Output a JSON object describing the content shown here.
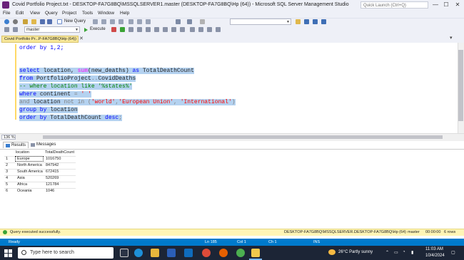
{
  "window": {
    "title": "Covid Portfolio Project.txt - DESKTOP-FA7G8BQ\\MSSQLSERVER1.master (DESKTOP-FA7G8BQ\\Hp (64)) - Microsoft SQL Server Management Studio",
    "quick_launch_placeholder": "Quick Launch (Ctrl+Q)",
    "minimize_glyph": "—",
    "maximize_glyph": "☐",
    "close_glyph": "✕"
  },
  "menu": [
    "File",
    "Edit",
    "View",
    "Query",
    "Project",
    "Tools",
    "Window",
    "Help"
  ],
  "toolbar": {
    "new_query_label": "New Query",
    "database_value": "master",
    "execute_label": "Execute"
  },
  "document_tab": {
    "label": "Covid Portfolio Pr...P-FA7G8BQ\\Hp (64))",
    "close_glyph": "✕",
    "active_color": "#f7e79a"
  },
  "editor": {
    "line_prev": "order by 1,2;",
    "code": {
      "l1_kw1": "select",
      "l1_a": " location, ",
      "l1_fn": "sum",
      "l1_b": "(new_deaths) ",
      "l1_kw2": "as",
      "l1_c": " TotalDeathCount",
      "l2_kw": "from",
      "l2_a": " PortfolioProject",
      "l2_gr": "..",
      "l2_b": "CovidDeaths",
      "l3_cm": "-- where location like '%states%'",
      "l4_kw": "where",
      "l4_a": " continent ",
      "l4_gr": "=",
      "l4_str": " ' '",
      "l5_kw1": "and",
      "l5_a": " location ",
      "l5_gr1": "not in",
      "l5_gr2": " (",
      "l5_str1": "'world'",
      "l5_gr3": ",",
      "l5_str2": "'European Union'",
      "l5_gr4": ", ",
      "l5_str3": "'International'",
      "l5_gr5": ")",
      "l6_kw": "group by",
      "l6_a": " location",
      "l7_kw1": "order by",
      "l7_a": " TotalDeathCount ",
      "l7_kw2": "desc",
      "l7_gr": ";"
    },
    "selection_color": "#b4d2f0"
  },
  "zoom": "136 %",
  "results": {
    "tabs": [
      "Results",
      "Messages"
    ],
    "columns": [
      "location",
      "TotalDeathCount"
    ],
    "rows": [
      {
        "n": "1",
        "location": "Europe",
        "count": "1016750"
      },
      {
        "n": "2",
        "location": "North America",
        "count": "847942"
      },
      {
        "n": "3",
        "location": "South America",
        "count": "672415"
      },
      {
        "n": "4",
        "location": "Asia",
        "count": "520269"
      },
      {
        "n": "5",
        "location": "Africa",
        "count": "121784"
      },
      {
        "n": "6",
        "location": "Oceania",
        "count": "1046"
      }
    ]
  },
  "query_status": {
    "message": "Query executed successfully.",
    "server": "DESKTOP-FA7G8BQ\\MSSQLSERVER...",
    "user": "DESKTOP-FA7G8BQ\\Hp (64)",
    "database": "master",
    "elapsed": "00:00:00",
    "rows": "6 rows"
  },
  "app_status": {
    "ready": "Ready",
    "ln": "Ln 185",
    "col": "Col 1",
    "ch": "Ch 1",
    "ins": "INS"
  },
  "taskbar": {
    "search_placeholder": "Type here to search",
    "weather": "26°C  Partly sunny",
    "time": "11:03 AM",
    "date": "10/4/2024",
    "colors": {
      "taskbar": "#1c2536",
      "status": "#007acc",
      "query_bar": "#fff5b6"
    }
  }
}
